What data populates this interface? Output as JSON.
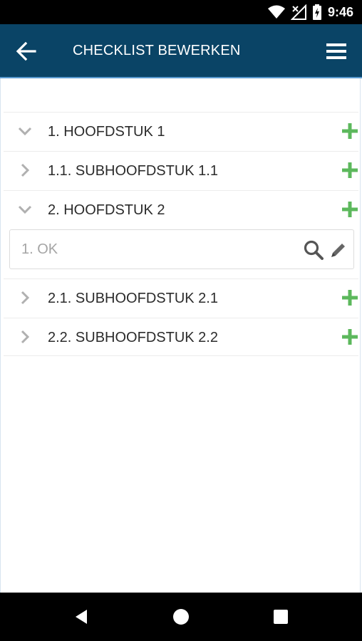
{
  "status_bar": {
    "time": "9:46",
    "icons": [
      "wifi-icon",
      "no-signal-icon",
      "battery-charging-icon"
    ]
  },
  "app_bar": {
    "title": "CHECKLIST BEWERKEN",
    "back_icon": "arrow-left-icon",
    "menu_icon": "hamburger-menu-icon"
  },
  "colors": {
    "app_bar_bg": "#0a4466",
    "add_icon": "#5cb85c",
    "chevron": "#b0b0b0"
  },
  "tree": {
    "rows": [
      {
        "label": "1. HOOFDSTUK 1",
        "state": "expanded"
      },
      {
        "label": "1.1. SUBHOOFDSTUK 1.1",
        "state": "collapsed"
      },
      {
        "label": "2. HOOFDSTUK 2",
        "state": "expanded"
      },
      {
        "label": "2.1. SUBHOOFDSTUK 2.1",
        "state": "collapsed"
      },
      {
        "label": "2.2. SUBHOOFDSTUK 2.2",
        "state": "collapsed"
      }
    ],
    "item": {
      "label": "1. OK"
    }
  },
  "nav_bar": {
    "buttons": [
      "back-triangle-icon",
      "home-circle-icon",
      "recents-square-icon"
    ]
  }
}
